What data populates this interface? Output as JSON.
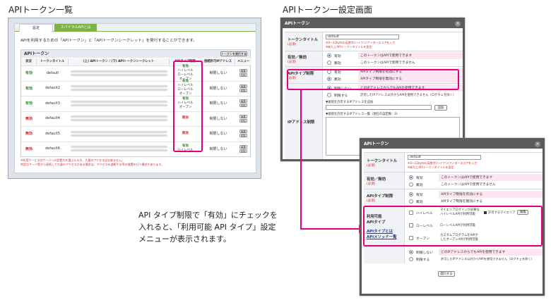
{
  "captions": {
    "left": "APIトークン一覧",
    "right": "APIトークン一設定画面"
  },
  "left_panel": {
    "tabs": [
      "設定",
      "スパイラルAPIとは"
    ],
    "description": "APIを利用するための「APIトークン」と「APIトークンシークレット」を発行することができます。",
    "table_title": "APIトークン",
    "issue_button": "トークンを発行する",
    "columns": [
      "状況",
      "トークンタイトル",
      "(上) APIトークン / (下) APIトークンシークレット",
      "APIタイプ制限",
      "接続許可IPアドレス",
      "メニュー"
    ],
    "rows": [
      {
        "status": "有効",
        "status_color": "#2e8b2e",
        "title": "default",
        "api_lines": [
          "有効",
          "ハイレベル",
          "ローレベル",
          "オープン"
        ],
        "ip": "制限しない",
        "btn1": "編集",
        "btn2": "削除"
      },
      {
        "status": "有効",
        "status_color": "#2e8b2e",
        "title": "default2",
        "api_lines": [
          "有効",
          "ハイレベル",
          "ローレベル",
          "オープン"
        ],
        "ip": "制限しない",
        "btn1": "編集",
        "btn2": "削除"
      },
      {
        "status": "有効",
        "status_color": "#2e8b2e",
        "title": "default3",
        "api_lines": [
          "有効",
          "ハイレベル",
          "オープン"
        ],
        "ip": "制限しない",
        "btn1": "編集",
        "btn2": "削除"
      },
      {
        "status": "無効",
        "status_color": "#d62c2c",
        "title": "default4",
        "api_lines": [
          "無効"
        ],
        "ip": "制限しない",
        "btn1": "編集",
        "btn2": "削除"
      },
      {
        "status": "無効",
        "status_color": "#d62c2c",
        "title": "default5",
        "api_lines": [
          "無効"
        ],
        "ip": "制限しない",
        "btn1": "編集",
        "btn2": "削除"
      },
      {
        "status": "無効",
        "status_color": "#d62c2c",
        "title": "default6",
        "api_lines": [
          "有効",
          "ハイレベル"
        ],
        "ip": "制限しない",
        "btn1": "編集",
        "btn2": "削除"
      }
    ],
    "notes": [
      "※利用サービスのサーバへの設置方を選ぶえる方、大量のアクセスは出来ません。",
      "特定のサーバ等から接続して大量のアクセスがある場合は、アクセスを遮断する等の措置を行う場合があります。"
    ]
  },
  "dialog1": {
    "title": "APIトークン",
    "token_title_label": "トークンタイトル",
    "required": "(必須)",
    "token_title_value": "default",
    "token_title_hint1": "※4～32byteの英数字/ハイフン/アンダースコアを入力",
    "token_title_hint2": "※新たにAPIトークンタイトルを設定",
    "valid_label": "有効／無効",
    "valid_options": [
      {
        "label": "有効",
        "desc": "このトークンはAPIで使用できます"
      },
      {
        "label": "無効",
        "desc": "このトークンはAPIで使用できません"
      }
    ],
    "api_type_label": "APIタイプ制限",
    "api_type_options": [
      {
        "label": "有効",
        "desc": "APIタイプ制限を有効にする"
      },
      {
        "label": "無効",
        "desc": "APIタイプ制限を無効にする"
      }
    ],
    "ip_options": [
      {
        "label": "制限しない",
        "desc": "どのIPアドレスからでもAPIを使用できます"
      },
      {
        "label": "制限する",
        "desc": "許可したIPアドレス以外からAPIを使用できません（ログチェを除く）"
      }
    ],
    "ip_label": "IPアドレス制限",
    "ip_add_label": "▼接続を許可するIPアドレスを追加",
    "ip_add_button": "追加",
    "ip_list_label": "▼接続を許可するIPアドレス一覧（現在の設定数：0）"
  },
  "dialog2": {
    "title": "APIトークン",
    "token_title_label": "トークンタイトル",
    "required": "(必須)",
    "token_title_value": "default",
    "token_title_hint1": "※4～32byteの英数字/ハイフン/アンダースコアを入力",
    "token_title_hint2": "※新たにAPIトークンタイトルを設定",
    "valid_label": "有効／無効",
    "valid_options": [
      {
        "label": "有効",
        "desc": "このトークンはAPIで使用できます"
      },
      {
        "label": "無効",
        "desc": "このトークンはAPIで使用できません"
      }
    ],
    "api_type_label": "APIタイプ制限",
    "api_type_options": [
      {
        "label": "有効",
        "desc": "APIタイプ制限を有効にする"
      },
      {
        "label": "無効",
        "desc": "APIタイプ制限を無効にする"
      }
    ],
    "usable_label1": "利用可能",
    "usable_label2": "APIタイプ",
    "usable_link1": "APIタイプとは",
    "usable_link2": "APIメソッド一覧",
    "usable_options": [
      {
        "label": "ハイレベル",
        "desc1": "マイエリアログインが必要な",
        "desc2": "ハイレベルAPIが利用可能"
      },
      {
        "label": "ローレベル",
        "desc1": "ローレベルAPIが利用可能",
        "desc2": ""
      },
      {
        "label": "オープン",
        "desc1": "カスタムプログラムをAPIが",
        "desc2": "したオープンAPIが利用可能"
      }
    ],
    "myarea_label": "許可するマイエリア",
    "myarea_button": "編集",
    "ip_options": [
      {
        "label": "制限しない",
        "desc": "どのIPアドレスからでもAPIを使用できます"
      },
      {
        "label": "制限する",
        "desc": "許可したIPアドレス以外からAPIを使用できません（ログチェを除く）"
      }
    ],
    "submit_label": "発行する"
  },
  "explanation": {
    "line1": "API タイプ制限で「有効」にチェックを",
    "line2": "入れると、「利用可能 API タイプ」設定",
    "line3": "メニューが表示されます。"
  },
  "colors": {
    "highlight": "#e6007e",
    "valid": "#2e8b2e",
    "invalid": "#d62c2c",
    "tab_green": "#7cb342"
  }
}
